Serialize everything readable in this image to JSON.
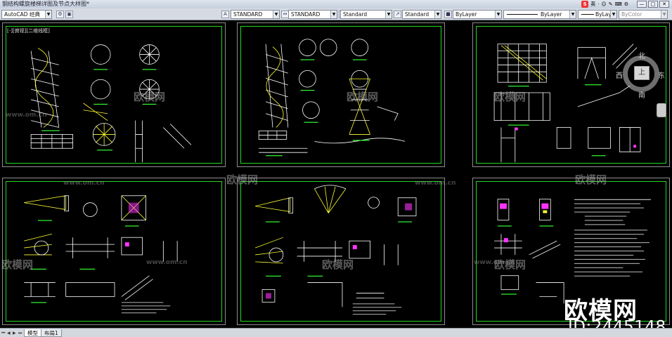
{
  "window": {
    "title": "钢结构螺旋楼梯详图及节点大样图*",
    "controls": [
      "—",
      "□",
      "✕"
    ]
  },
  "ime": {
    "logo": "S",
    "items": [
      "英",
      "·",
      "☺",
      "✎",
      "⌨",
      "⚙"
    ]
  },
  "toolbar": {
    "workspace": "AutoCAD 经典",
    "text_style": "STANDARD",
    "dim_style": "STANDARD",
    "table_style": "Standard",
    "multileader_style": "Standard",
    "layer": "ByLayer",
    "linetype": "ByLayer",
    "lineweight": "ByLayer",
    "plot_color": "ByColor"
  },
  "sheets": [
    {
      "id": "1",
      "tag": "[-][俯视][二维线框]"
    },
    {
      "id": "2",
      "tag": ""
    },
    {
      "id": "3",
      "tag": ""
    },
    {
      "id": "4",
      "tag": ""
    },
    {
      "id": "5",
      "tag": ""
    },
    {
      "id": "6",
      "tag": ""
    }
  ],
  "viewcube": {
    "top": "上",
    "north": "北",
    "south": "南",
    "east": "东",
    "west": "西"
  },
  "watermarks": {
    "brand_small": "欧模网",
    "url": "www.om.cn",
    "brand_large": "欧模网",
    "id_text": "ID:2445148"
  },
  "tabs": [
    {
      "label": "模型",
      "active": true
    },
    {
      "label": "布局1",
      "active": false
    }
  ],
  "colors": {
    "sheet_border": "#22d822",
    "linework": "#ffffff",
    "detail": "#ffff33",
    "hatch": "#ff33ff",
    "annotation": "#33ffff"
  }
}
